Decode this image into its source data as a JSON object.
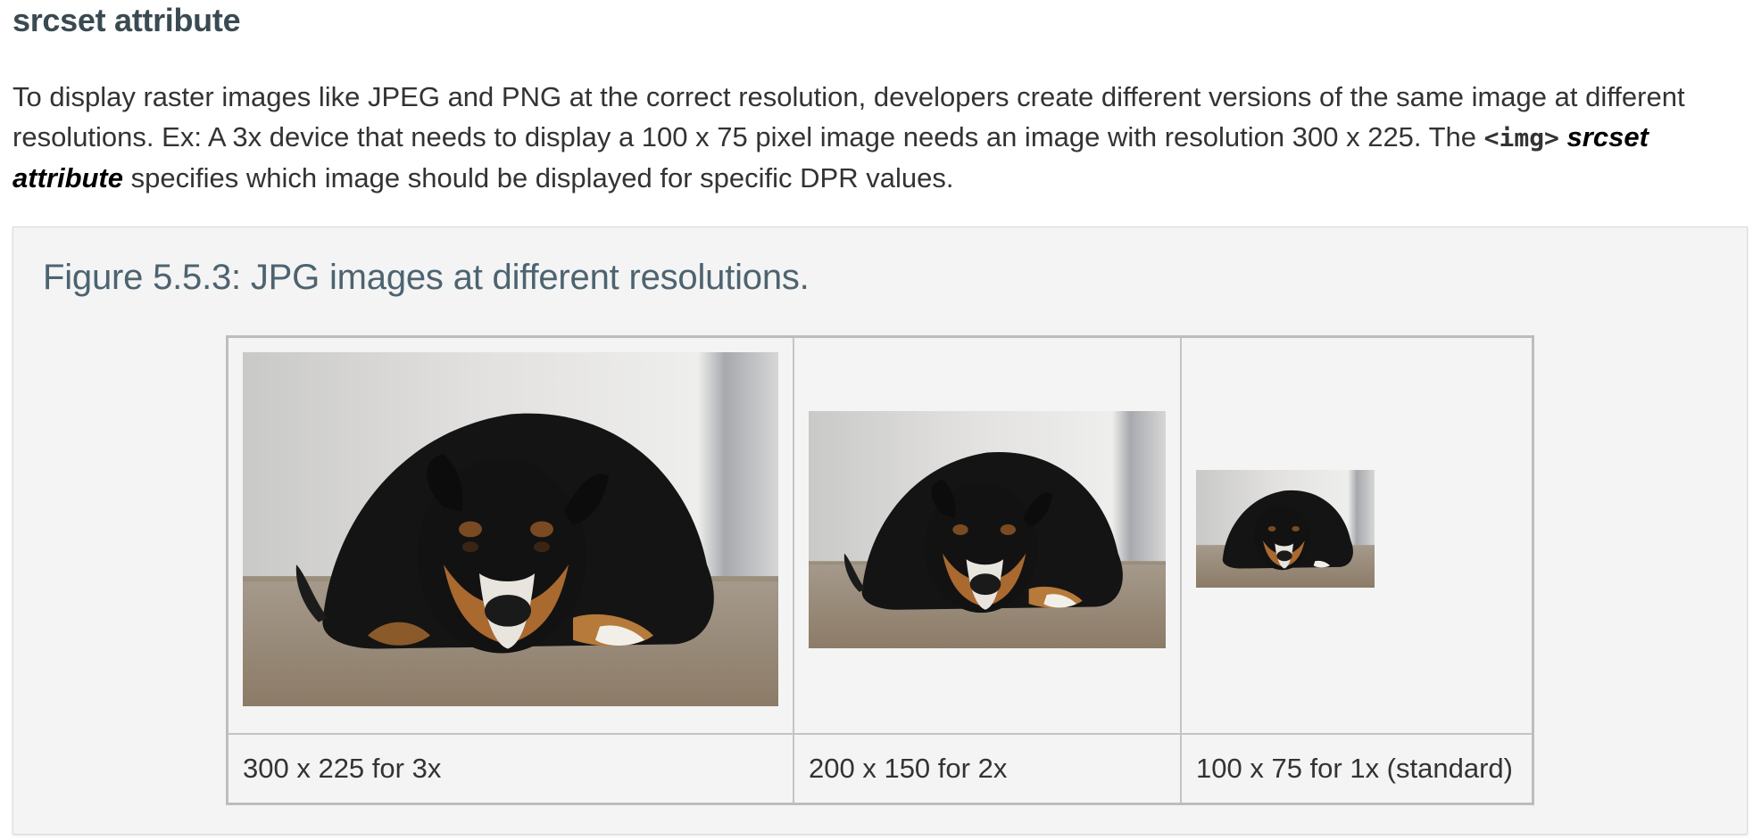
{
  "section": {
    "heading": "srcset attribute",
    "paragraph": {
      "text_before": "To display raster images like JPEG and PNG at the correct resolution, developers create different versions of the same image at different resolutions. Ex: A 3x device that needs to display a 100 x 75 pixel image needs an image with resolution 300 x 225. The ",
      "code": "<img>",
      "term": "srcset attribute",
      "text_after": " specifies which image should be displayed for specific DPR values."
    }
  },
  "figure": {
    "caption": "Figure 5.5.3: JPG images at different resolutions.",
    "images": [
      {
        "label": "300 x 225 for 3x",
        "icon": "dog-photo-large"
      },
      {
        "label": "200 x 150 for 2x",
        "icon": "dog-photo-medium"
      },
      {
        "label": "100 x 75 for 1x (standard)",
        "icon": "dog-photo-small"
      }
    ]
  },
  "colors": {
    "heading": "#3a4a52",
    "caption": "#4d6370",
    "figure_background": "#f4f4f4",
    "table_border": "#bdbdbd"
  }
}
